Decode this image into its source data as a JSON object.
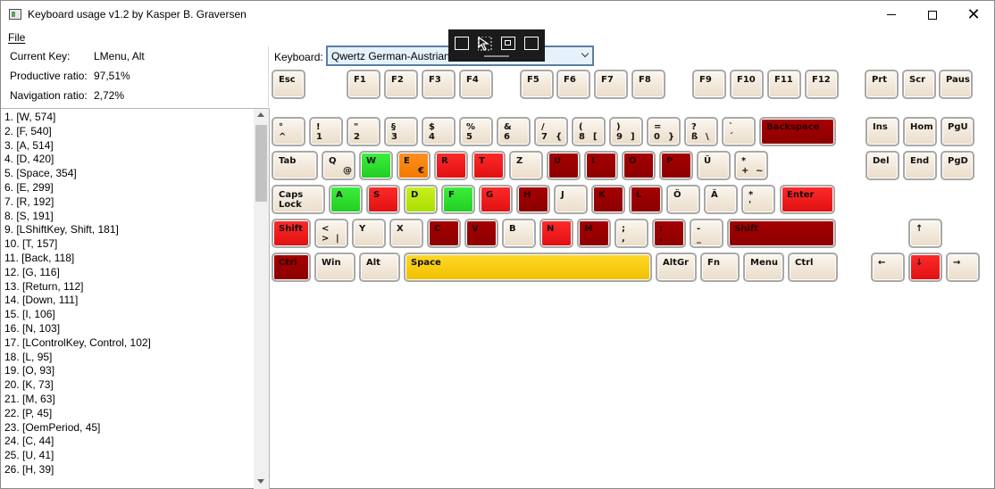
{
  "window": {
    "title": "Keyboard usage v1.2 by Kasper B. Graversen"
  },
  "menu": {
    "file": "File"
  },
  "stats": {
    "current_key_label": "Current Key:",
    "current_key_value": "LMenu, Alt",
    "productive_label": "Productive ratio:",
    "productive_value": "97,51%",
    "navigation_label": "Navigation ratio:",
    "navigation_value": "2,72%"
  },
  "keyboard_selector": {
    "label": "Keyboard:",
    "value": "Qwertz German-Austrian"
  },
  "floating_toolbar": {
    "icons": [
      "select-element-icon",
      "pointer-icon",
      "frame-icon",
      "capture-icon"
    ]
  },
  "colors": {
    "hot_red": "#e01010",
    "dark_red": "#8b0000",
    "green": "#22cc22",
    "orange": "#f07800",
    "yellow": "#f0c000",
    "lime": "#aadd00"
  },
  "usage_list": [
    "1. [W, 574]",
    "2. [F, 540]",
    "3. [A, 514]",
    "4. [D, 420]",
    "5. [Space, 354]",
    "6. [E, 299]",
    "7. [R, 192]",
    "8. [S, 191]",
    "9. [LShiftKey, Shift, 181]",
    "10. [T, 157]",
    "11. [Back, 118]",
    "12. [G, 116]",
    "13. [Return, 112]",
    "14. [Down, 111]",
    "15. [I, 106]",
    "16. [N, 103]",
    "17. [LControlKey, Control, 102]",
    "18. [L, 95]",
    "19. [O, 93]",
    "20. [K, 73]",
    "21. [M, 63]",
    "22. [P, 45]",
    "23. [OemPeriod, 45]",
    "24. [C, 44]",
    "25. [U, 41]",
    "26. [H, 39]"
  ],
  "keys": {
    "esc": "Esc",
    "f1": "F1",
    "f2": "F2",
    "f3": "F3",
    "f4": "F4",
    "f5": "F5",
    "f6": "F6",
    "f7": "F7",
    "f8": "F8",
    "f9": "F9",
    "f10": "F10",
    "f11": "F11",
    "f12": "F12",
    "prt": "Prt",
    "scr": "Scr",
    "paus": "Paus",
    "grave_top": "°",
    "grave_bot": "^",
    "d1_top": "!",
    "d1_bot": "1",
    "d2_top": "\"",
    "d2_bot": "2",
    "d3_top": "§",
    "d3_bot": "3",
    "d4_top": "$",
    "d4_bot": "4",
    "d5_top": "%",
    "d5_bot": "5",
    "d6_top": "&",
    "d6_bot": "6",
    "d7_top": "/",
    "d7_bot": "7",
    "d7_alt": "{",
    "d8_top": "(",
    "d8_bot": "8",
    "d8_alt": "[",
    "d9_top": ")",
    "d9_bot": "9",
    "d9_alt": "]",
    "d0_top": "=",
    "d0_bot": "0",
    "d0_alt": "}",
    "ss_top": "?",
    "ss_bot": "ß",
    "ss_alt": "\\",
    "acc_top": "`",
    "acc_bot": "´",
    "backspace": "Backspace",
    "ins": "Ins",
    "hom": "Hom",
    "pgu": "PgU",
    "tab": "Tab",
    "q": "Q",
    "q_alt": "@",
    "w": "W",
    "e": "E",
    "e_alt": "€",
    "r": "R",
    "t": "T",
    "z": "Z",
    "u": "U",
    "i": "I",
    "o": "O",
    "p": "P",
    "ue": "Ü",
    "plus_top": "*",
    "plus_bot": "+",
    "plus_alt": "~",
    "del": "Del",
    "end": "End",
    "pgd": "PgD",
    "caps1": "Caps",
    "caps2": "Lock",
    "a": "A",
    "s": "S",
    "d": "D",
    "f": "F",
    "g": "G",
    "h": "H",
    "j": "J",
    "k": "K",
    "l": "L",
    "oe": "Ö",
    "ae": "Ä",
    "hash_top": "*",
    "hash_bot": "'",
    "enter": "Enter",
    "lshift": "Shift",
    "lt_top": "<",
    "lt_bot": ">",
    "lt_alt": "|",
    "y": "Y",
    "x": "X",
    "c": "C",
    "v": "V",
    "b": "B",
    "n": "N",
    "m": "M",
    "comma_top": ";",
    "comma_bot": ",",
    "period_top": ":",
    "period_bot": ".",
    "minus_top": "-",
    "minus_bot": "_",
    "rshift": "Shift",
    "up": "↑",
    "lctrl": "Ctrl",
    "win": "Win",
    "alt": "Alt",
    "space": "Space",
    "altgr": "AltGr",
    "fn": "Fn",
    "menu": "Menu",
    "rctrl": "Ctrl",
    "left": "←",
    "down": "↓",
    "right": "→"
  }
}
